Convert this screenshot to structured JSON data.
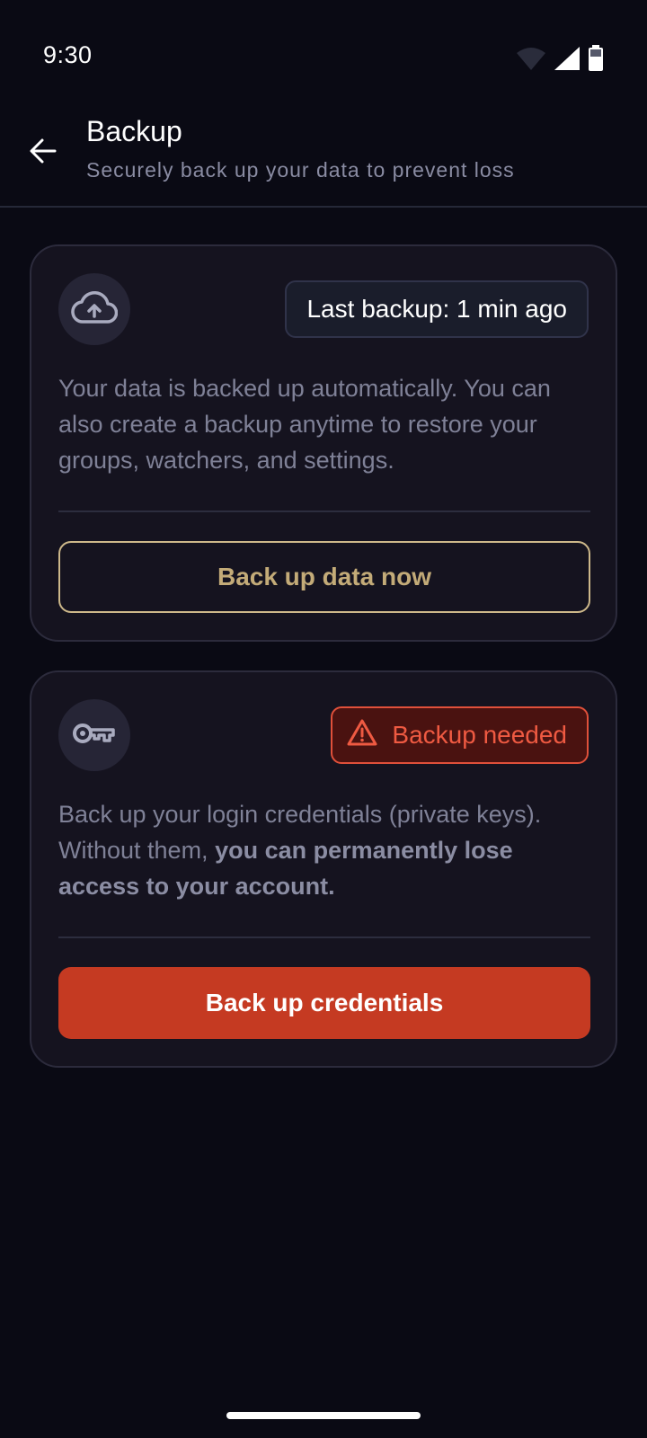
{
  "status_bar": {
    "time": "9:30",
    "icons": [
      "wifi-icon",
      "cellular-signal-icon",
      "battery-icon"
    ]
  },
  "header": {
    "back_icon": "arrow-back-icon",
    "title": "Backup",
    "subtitle": "Securely back up your data to prevent loss"
  },
  "data_backup": {
    "icon": "cloud-upload-icon",
    "status": "Last backup: 1 min ago",
    "description": "Your data is backed up automatically. You can also create a backup anytime to restore your groups, watchers, and settings.",
    "button_label": "Back up data now"
  },
  "credentials_backup": {
    "icon": "key-icon",
    "status_icon": "warning-icon",
    "status": "Backup needed",
    "description_start": "Back up your login credentials (private keys). Without them, ",
    "description_bold": "you can permanently lose access to your account.",
    "button_label": "Back up credentials"
  },
  "colors": {
    "background": "#0a0a14",
    "card": "#15131f",
    "accent_gold": "#c3ab78",
    "danger": "#c53a22",
    "danger_text": "#ef5a42"
  }
}
